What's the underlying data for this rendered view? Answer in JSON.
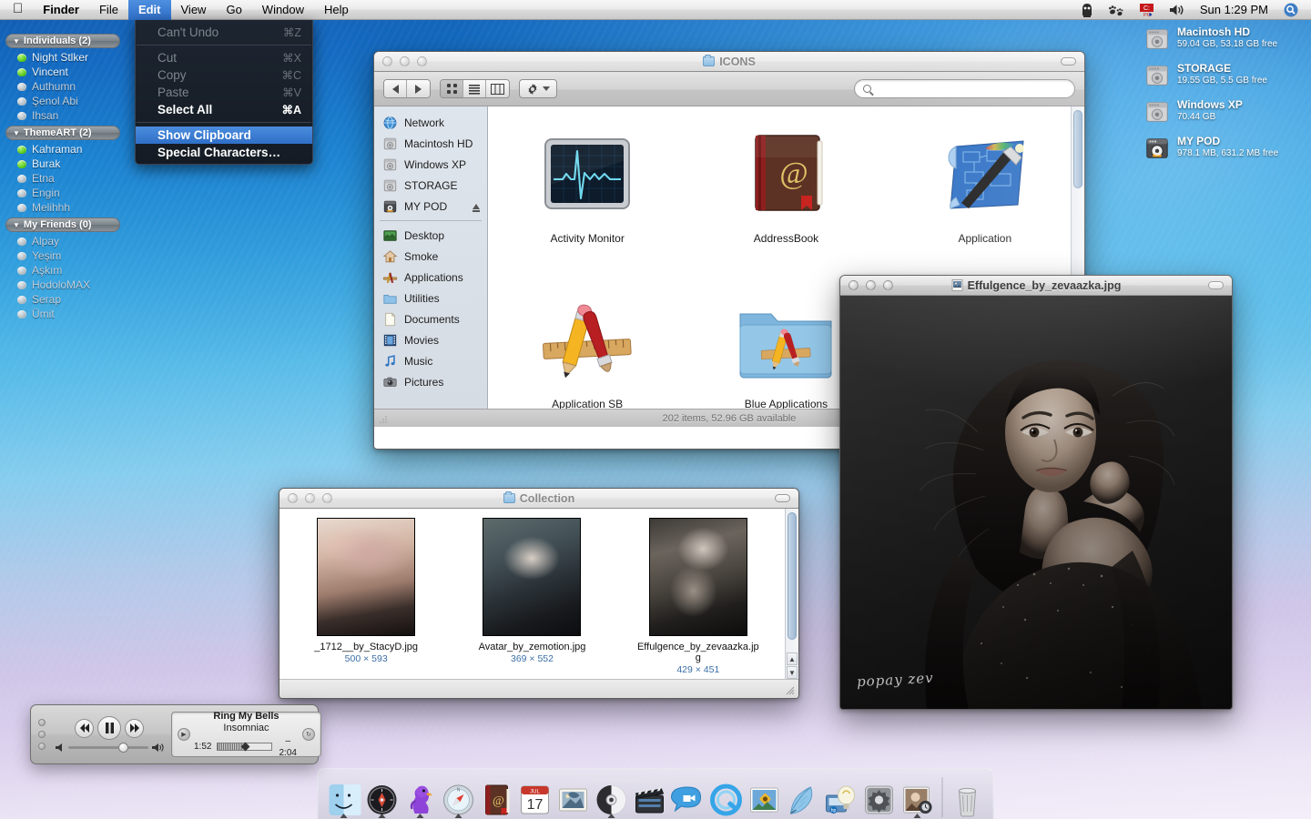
{
  "menubar": {
    "apple_icon": "apple-logo-icon",
    "items": [
      {
        "label": "Finder",
        "bold": true,
        "active": false
      },
      {
        "label": "File",
        "bold": false,
        "active": false
      },
      {
        "label": "Edit",
        "bold": false,
        "active": true
      },
      {
        "label": "View",
        "bold": false,
        "active": false
      },
      {
        "label": "Go",
        "bold": false,
        "active": false
      },
      {
        "label": "Window",
        "bold": false,
        "active": false
      },
      {
        "label": "Help",
        "bold": false,
        "active": false
      }
    ],
    "extras": [
      "ghost-icon",
      "paw-prints-icon",
      "parallels-pc-icon",
      "volume-icon"
    ],
    "clock": "Sun 1:29 PM",
    "spotlight_icon": "spotlight-search-icon"
  },
  "edit_menu": {
    "rows": [
      {
        "label": "Can't Undo",
        "key": "⌘Z",
        "state": "disabled"
      },
      {
        "sep": true
      },
      {
        "label": "Cut",
        "key": "⌘X",
        "state": "disabled"
      },
      {
        "label": "Copy",
        "key": "⌘C",
        "state": "disabled"
      },
      {
        "label": "Paste",
        "key": "⌘V",
        "state": "disabled"
      },
      {
        "label": "Select All",
        "key": "⌘A",
        "state": "strong"
      },
      {
        "sep": true
      },
      {
        "label": "Show Clipboard",
        "key": "",
        "state": "selected"
      },
      {
        "label": "Special Characters…",
        "key": "",
        "state": "strong"
      }
    ]
  },
  "buddy_list": {
    "groups": [
      {
        "title": "Individuals (2)",
        "buddies": [
          {
            "name": "Night Stlker",
            "status": "online"
          },
          {
            "name": "Vincent",
            "status": "online"
          },
          {
            "name": "Authumn",
            "status": "offline"
          },
          {
            "name": "Şenol Abi",
            "status": "offline"
          },
          {
            "name": "Ihsan",
            "status": "offline"
          }
        ]
      },
      {
        "title": "ThemeART (2)",
        "buddies": [
          {
            "name": "Kahraman",
            "status": "online"
          },
          {
            "name": "Burak",
            "status": "online"
          },
          {
            "name": "Etna",
            "status": "offline"
          },
          {
            "name": "Engin",
            "status": "offline"
          },
          {
            "name": "Melihhh",
            "status": "offline"
          }
        ]
      },
      {
        "title": "My Friends (0)",
        "buddies": [
          {
            "name": "Alpay",
            "status": "offline"
          },
          {
            "name": "Yeşim",
            "status": "offline"
          },
          {
            "name": "Aşkım",
            "status": "offline"
          },
          {
            "name": "HodoloMAX",
            "status": "offline"
          },
          {
            "name": "Serap",
            "status": "offline"
          },
          {
            "name": "Ümit",
            "status": "offline"
          }
        ]
      }
    ]
  },
  "desktop_drives": [
    {
      "name": "Macintosh HD",
      "info": "59.04 GB, 53.18 GB free",
      "icon": "hard-drive-icon"
    },
    {
      "name": "STORAGE",
      "info": "19.55 GB, 5.5 GB free",
      "icon": "hard-drive-icon"
    },
    {
      "name": "Windows XP",
      "info": "70.44 GB",
      "icon": "hard-drive-icon"
    },
    {
      "name": "MY POD",
      "info": "978.1 MB, 631.2 MB free",
      "icon": "ipod-drive-icon"
    }
  ],
  "finder_window": {
    "title": "ICONS",
    "search_placeholder": "",
    "search_value": "",
    "toolbar": {
      "back_label": "Back",
      "forward_label": "Forward",
      "view_icon_label": "Icon View",
      "view_list_label": "List View",
      "view_column_label": "Column View",
      "action_label": "Action"
    },
    "sidebar": {
      "devices": [
        {
          "label": "Network",
          "icon": "network-globe-icon"
        },
        {
          "label": "Macintosh HD",
          "icon": "hard-drive-icon"
        },
        {
          "label": "Windows XP",
          "icon": "hard-drive-icon"
        },
        {
          "label": "STORAGE",
          "icon": "hard-drive-icon"
        },
        {
          "label": "MY POD",
          "icon": "ipod-drive-icon",
          "eject": true
        }
      ],
      "places": [
        {
          "label": "Desktop",
          "icon": "desktop-icon"
        },
        {
          "label": "Smoke",
          "icon": "home-icon"
        },
        {
          "label": "Applications",
          "icon": "applications-icon"
        },
        {
          "label": "Utilities",
          "icon": "folder-icon"
        },
        {
          "label": "Documents",
          "icon": "document-icon"
        },
        {
          "label": "Movies",
          "icon": "movies-icon"
        },
        {
          "label": "Music",
          "icon": "music-note-icon"
        },
        {
          "label": "Pictures",
          "icon": "camera-icon"
        }
      ]
    },
    "items": [
      {
        "name": "Activity Monitor",
        "icon": "activity-monitor-icon"
      },
      {
        "name": "AddressBook",
        "icon": "address-book-icon"
      },
      {
        "name": "Application",
        "icon": "blueprint-wand-icon"
      },
      {
        "name": "Application SB",
        "icon": "pencil-ruler-brush-icon"
      },
      {
        "name": "Blue Applications",
        "icon": "blue-applications-folder-icon"
      }
    ],
    "status": "202 items, 52.96 GB available"
  },
  "collection_window": {
    "title": "Collection",
    "items": [
      {
        "name": "_1712__by_StacyD.jpg",
        "dimensions": "500 × 593"
      },
      {
        "name": "Avatar_by_zemotion.jpg",
        "dimensions": "369 × 552"
      },
      {
        "name": "Effulgence_by_zevaazka.jpg",
        "dimensions": "429 × 451"
      }
    ]
  },
  "preview_window": {
    "title": "Effulgence_by_zevaazka.jpg",
    "icon": "jpeg-file-icon",
    "signature": "popay zev"
  },
  "itunes_mini": {
    "track": "Ring My Bells",
    "artist": "Insomniac",
    "elapsed": "1:52",
    "remaining": "–2:04",
    "rewind_icon": "rewind-icon",
    "play_pause_icon": "pause-icon",
    "forward_icon": "fast-forward-icon"
  },
  "dock": {
    "items": [
      {
        "name": "Finder",
        "icon": "finder-icon",
        "running": true
      },
      {
        "name": "Dashboard",
        "icon": "dashboard-compass-icon",
        "running": true
      },
      {
        "name": "Adium",
        "icon": "adium-duck-icon",
        "running": true
      },
      {
        "name": "Safari",
        "icon": "safari-compass-icon",
        "running": true
      },
      {
        "name": "Address Book",
        "icon": "address-book-icon",
        "running": false
      },
      {
        "name": "iCal",
        "icon": "ical-icon",
        "running": false
      },
      {
        "name": "Mail",
        "icon": "mail-stamp-icon",
        "running": false
      },
      {
        "name": "iDVD",
        "icon": "dvd-disc-icon",
        "running": true
      },
      {
        "name": "iMovie",
        "icon": "clapperboard-icon",
        "running": false
      },
      {
        "name": "iChat",
        "icon": "ichat-bubble-icon",
        "running": false
      },
      {
        "name": "QuickTime",
        "icon": "quicktime-icon",
        "running": false
      },
      {
        "name": "iPhoto",
        "icon": "iphoto-sunflower-icon",
        "running": false
      },
      {
        "name": "Feather",
        "icon": "feather-quill-icon",
        "running": false
      },
      {
        "name": "HP Utility",
        "icon": "hp-lamp-icon",
        "running": false
      },
      {
        "name": "System Preferences",
        "icon": "system-preferences-gear-icon",
        "running": false
      },
      {
        "name": "Photo Booth",
        "icon": "photo-booth-icon",
        "running": true
      }
    ],
    "trash": {
      "name": "Trash",
      "icon": "trash-icon"
    },
    "ical_day": "17",
    "ical_month": "JUL"
  }
}
